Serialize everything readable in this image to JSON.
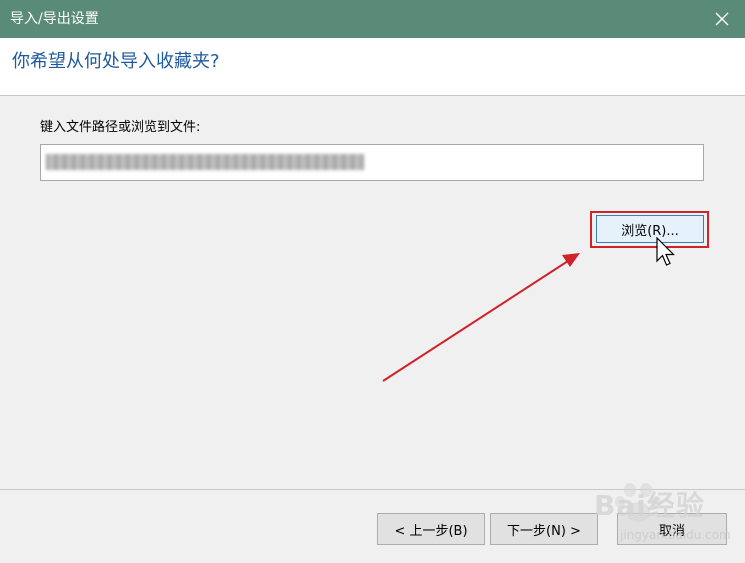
{
  "window": {
    "title": "导入/导出设置",
    "close_icon": "close-icon"
  },
  "header": {
    "heading": "你希望从何处导入收藏夹?"
  },
  "body": {
    "field_label": "键入文件路径或浏览到文件:",
    "path_value": "",
    "browse_label": "浏览(R)..."
  },
  "footer": {
    "back_label": "< 上一步(B)",
    "next_label": "下一步(N) >",
    "cancel_label": "取消"
  },
  "watermark": {
    "logo_text": "Bai经验",
    "url": "jingyan.baidu.com"
  },
  "colors": {
    "titlebar": "#5a8a78",
    "heading": "#1f5a9c",
    "annotation": "#d0222a",
    "button_focus": "#e5f1fb"
  }
}
